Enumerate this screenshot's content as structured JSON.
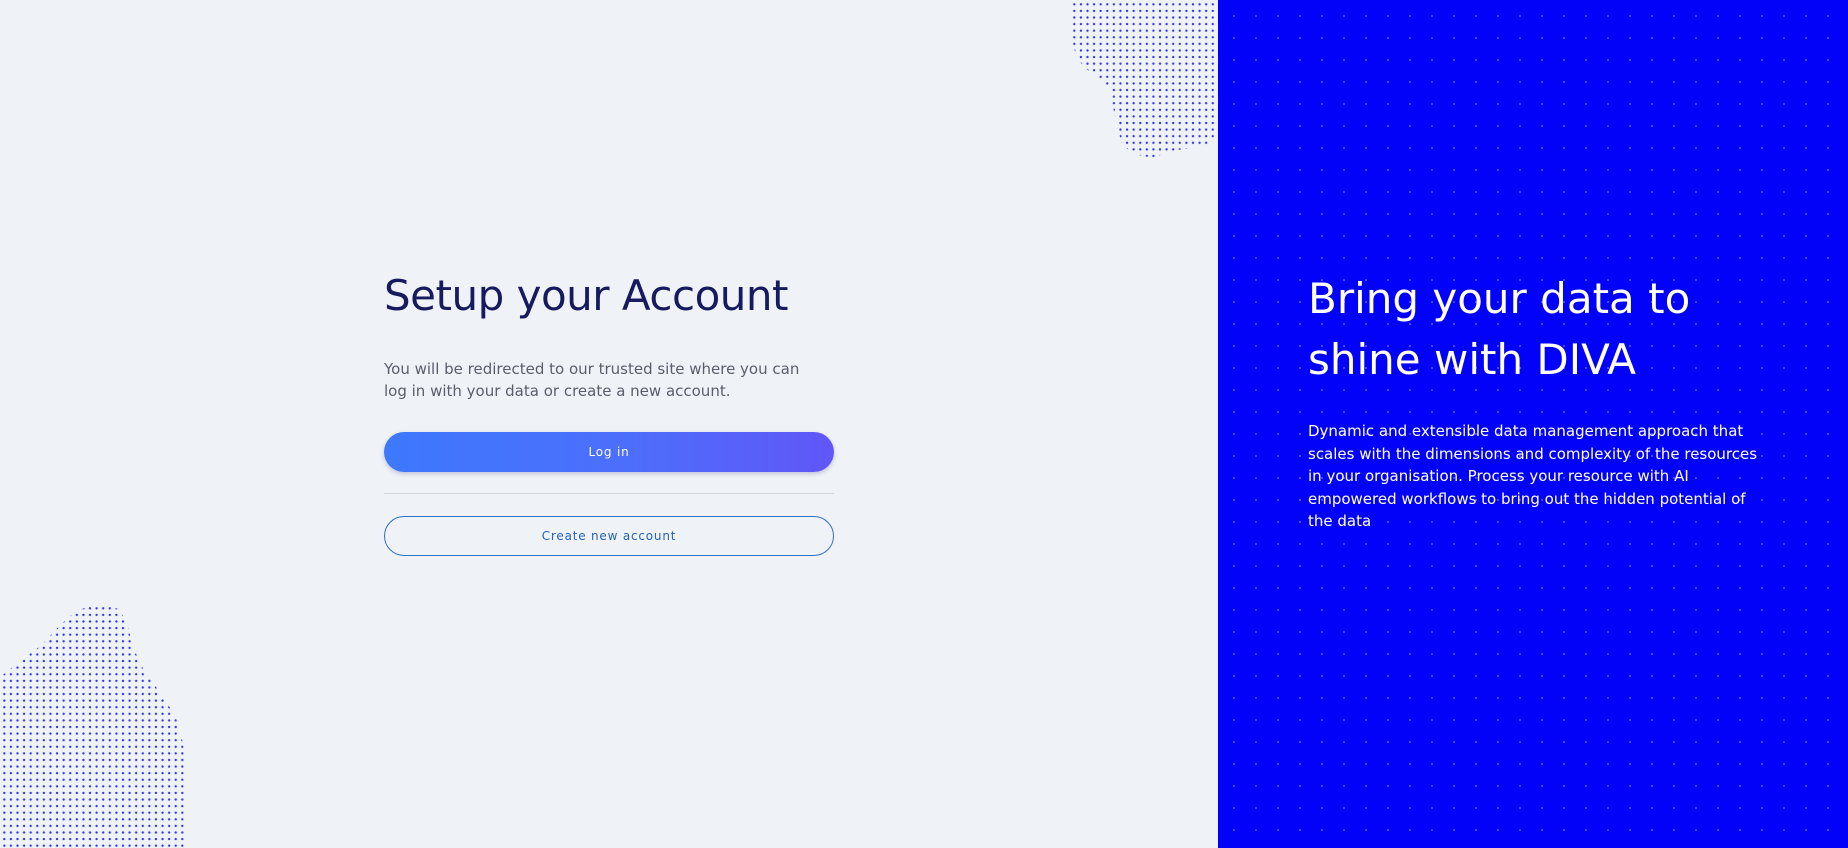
{
  "setup": {
    "title": "Setup your Account",
    "description": "You will be redirected to our trusted site where you can log in with your data or create a new account.",
    "login_label": "Log in",
    "create_account_label": "Create new account"
  },
  "promo": {
    "heading": "Bring your data to shine with DIVA",
    "body": "Dynamic and extensible data management approach that scales with the dimensions and complexity of the resources in your organisation. Process your resource with AI empowered workflows to bring out the hidden potential of the data"
  },
  "colors": {
    "page_background": "#eff2f6",
    "title": "#171a5e",
    "accent_gradient_start": "#3d78fd",
    "accent_gradient_end": "#6156f8",
    "secondary_button_border": "#2e72c4",
    "promo_background": "#0202f8",
    "dot_pattern": "#3535ee"
  }
}
